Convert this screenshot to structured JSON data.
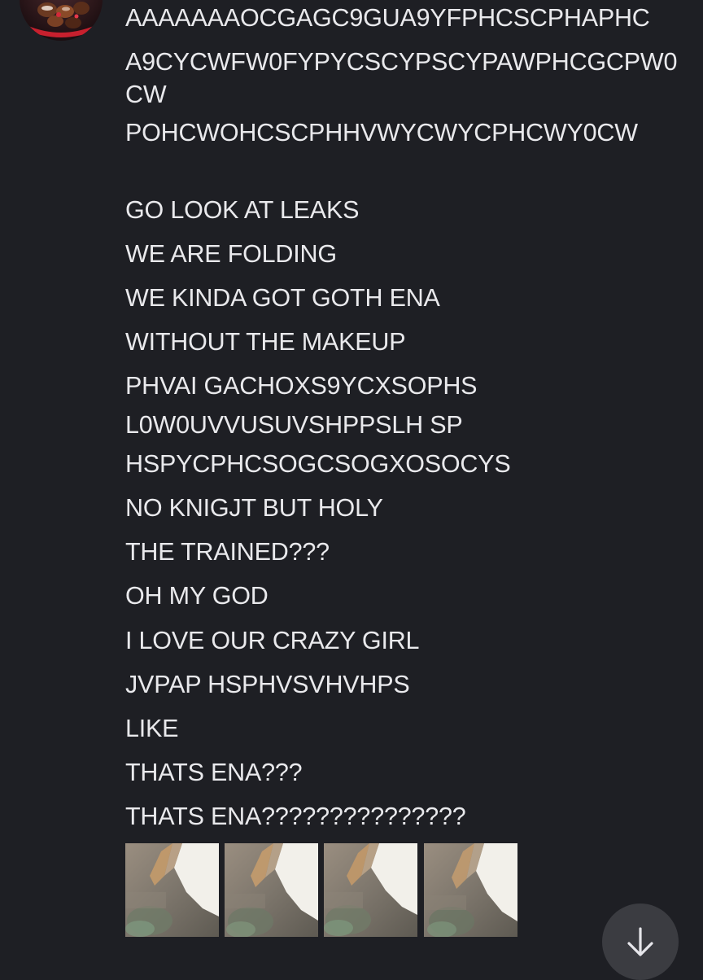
{
  "message": {
    "lines": [
      "AAAAAAAOCGAGC9GUA9YFPHCSCPHAPHC",
      "A9CYCWFW0FYPYCSCYPSCYPAWPHCGCPW0",
      "CW",
      "POHCWOHCSCPHHVWYCWYCPHCWY0CW",
      "GO LOOK AT LEAKS",
      "WE ARE FOLDING",
      "WE KINDA GOT GOTH ENA",
      "WITHOUT THE MAKEUP",
      "PHVAI GACHOXS9YCXSOPHS",
      "L0W0UVVUSUVSHPPSLH SP",
      "HSPYCPHCSOGCSOGXOSOCYS",
      "NO KNIGJT BUT HOLY",
      "THE TRAINED???",
      "OH MY GOD",
      "I LOVE OUR CRAZY GIRL",
      "JVPAP HSPHVSVHVHPS",
      "LIKE",
      "THATS ENA???",
      "THATS ENA???????????????"
    ]
  },
  "attachments": {
    "count": 4,
    "image_description": "blurry cropped image of a figure"
  },
  "icons": {
    "avatar": "user-avatar",
    "scroll_down": "arrow-down-icon"
  },
  "colors": {
    "background": "#1e1f24",
    "text": "#e9e9ec",
    "scroll_button": "#3b3c41"
  }
}
